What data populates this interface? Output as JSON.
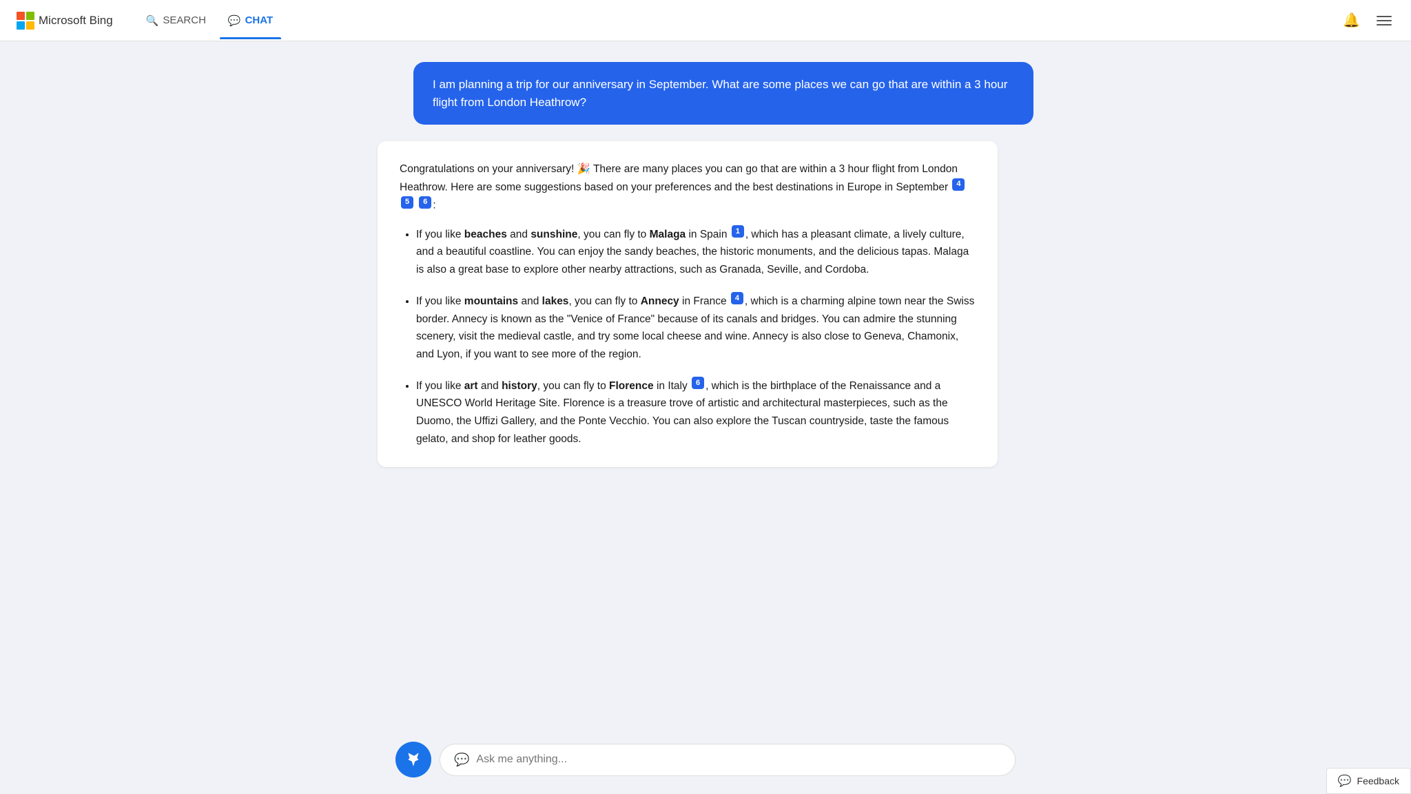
{
  "header": {
    "logo_text": "Microsoft Bing",
    "nav": [
      {
        "id": "search",
        "label": "SEARCH",
        "active": false
      },
      {
        "id": "chat",
        "label": "CHAT",
        "active": true
      }
    ]
  },
  "user_message": "I am planning a trip for our anniversary in September. What are some places we can go that are within a 3 hour flight from London Heathrow?",
  "ai_response": {
    "intro": "Congratulations on your anniversary! 🎉 There are many places you can go that are within a 3 hour flight from London Heathrow. Here are some suggestions based on your preferences and the best destinations in Europe in September",
    "intro_citations": [
      "4",
      "5",
      "6"
    ],
    "items": [
      {
        "prefix": "If you like ",
        "bold1": "beaches",
        "mid1": " and ",
        "bold2": "sunshine",
        "mid2": ", you can fly to ",
        "destination": "Malaga",
        "suffix": " in Spain",
        "citation": "1",
        "detail": ", which has a pleasant climate, a lively culture, and a beautiful coastline. You can enjoy the sandy beaches, the historic monuments, and the delicious tapas. Malaga is also a great base to explore other nearby attractions, such as Granada, Seville, and Cordoba."
      },
      {
        "prefix": "If you like ",
        "bold1": "mountains",
        "mid1": " and ",
        "bold2": "lakes",
        "mid2": ", you can fly to ",
        "destination": "Annecy",
        "suffix": " in France",
        "citation": "4",
        "detail": ", which is a charming alpine town near the Swiss border. Annecy is known as the \"Venice of France\" because of its canals and bridges. You can admire the stunning scenery, visit the medieval castle, and try some local cheese and wine. Annecy is also close to Geneva, Chamonix, and Lyon, if you want to see more of the region."
      },
      {
        "prefix": "If you like ",
        "bold1": "art",
        "mid1": " and ",
        "bold2": "history",
        "mid2": ", you can fly to ",
        "destination": "Florence",
        "suffix": " in Italy",
        "citation": "6",
        "detail": ", which is the birthplace of the Renaissance and a UNESCO World Heritage Site. Florence is a treasure trove of artistic and architectural masterpieces, such as the Duomo, the Uffizi Gallery, and the Ponte Vecchio. You can also explore the Tuscan countryside, taste the famous gelato, and shop for leather goods."
      }
    ]
  },
  "input": {
    "placeholder": "Ask me anything..."
  },
  "feedback": {
    "label": "Feedback"
  }
}
